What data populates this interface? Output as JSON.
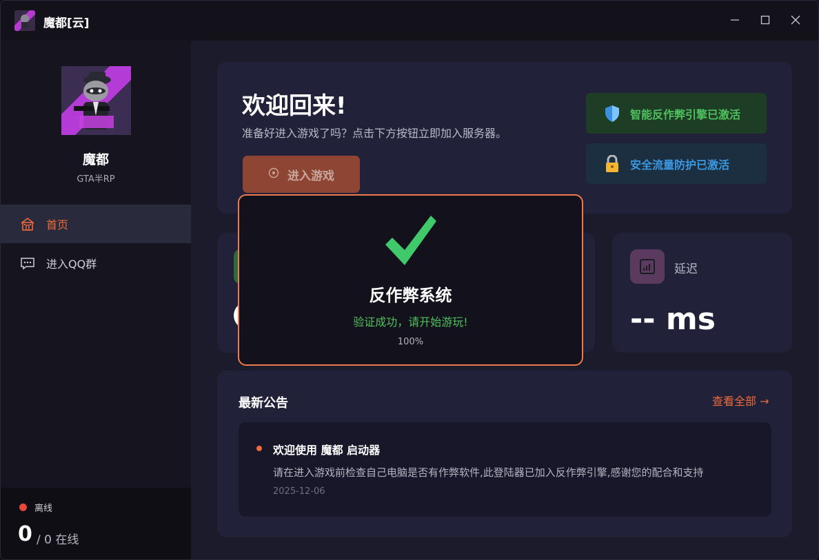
{
  "window": {
    "title": "魔都[云]",
    "minimize_icon": "minimize-icon",
    "maximize_icon": "maximize-icon",
    "close_icon": "close-icon"
  },
  "sidebar": {
    "brand_name": "魔都",
    "brand_sub": "GTA半RP",
    "nav": [
      {
        "label": "首页",
        "icon": "home-icon",
        "active": true
      },
      {
        "label": "进入QQ群",
        "icon": "chat-icon",
        "active": false
      }
    ],
    "status": {
      "label": "离线",
      "online": "0",
      "total": "/ 0 在线",
      "color": "#e9473a"
    }
  },
  "welcome": {
    "title": "欢迎回来!",
    "subtitle": "准备好进入游戏了吗？点击下方按钮立即加入服务器。",
    "play_button": "进入游戏",
    "badges": [
      {
        "label": "智能反作弊引擎已激活",
        "icon": "shield-icon",
        "color": "#4fc05d"
      },
      {
        "label": "安全流量防护已激活",
        "icon": "lock-icon",
        "color": "#3a98e3"
      }
    ]
  },
  "stats": {
    "latency_label": "延迟",
    "latency_value": "-- ms"
  },
  "notices": {
    "title": "最新公告",
    "view_all": "查看全部 →",
    "items": [
      {
        "title": "欢迎使用 魔都 启动器",
        "body": "请在进入游戏前检查自己电脑是否有作弊软件,此登陆器已加入反作弊引擎,感谢您的配合和支持",
        "date": "2025-12-06"
      }
    ]
  },
  "dialog": {
    "title": "反作弊系统",
    "message": "验证成功，请开始游玩!",
    "progress": "100%",
    "icon": "check-icon"
  },
  "colors": {
    "accent": "#ef6a3a",
    "success": "#4fc05d",
    "info": "#3a98e3"
  }
}
